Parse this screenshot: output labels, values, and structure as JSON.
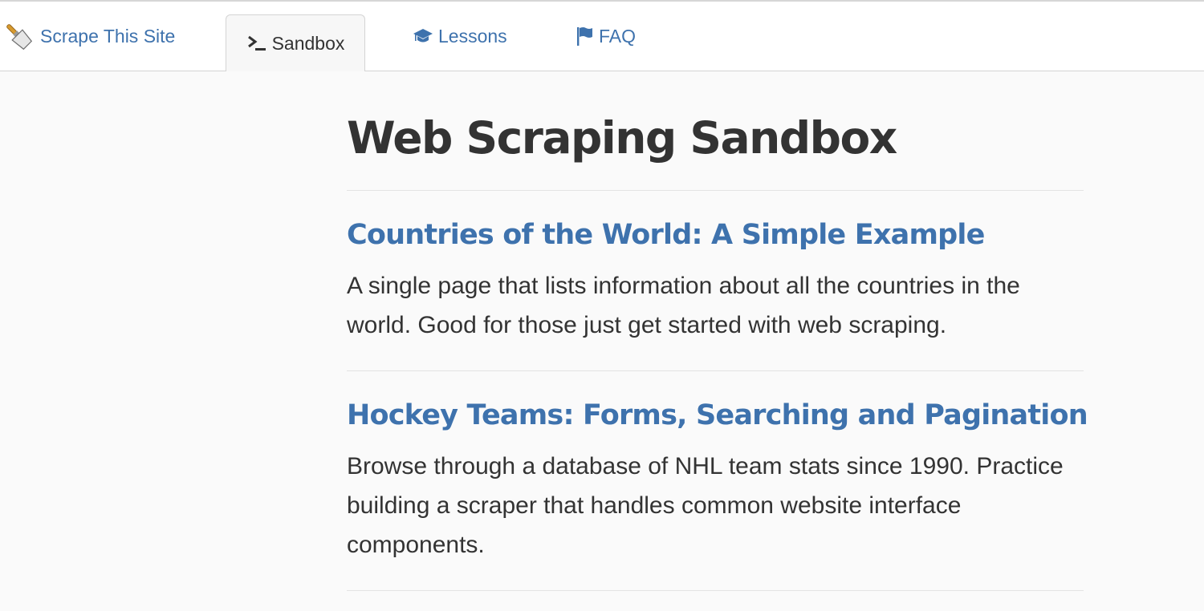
{
  "navbar": {
    "brand": {
      "label": "Scrape This Site",
      "icon": "spatula-icon"
    },
    "items": [
      {
        "label": "Sandbox",
        "icon": "terminal-icon",
        "active": true
      },
      {
        "label": "Lessons",
        "icon": "graduation-cap-icon",
        "active": false
      },
      {
        "label": "FAQ",
        "icon": "flag-icon",
        "active": false
      }
    ]
  },
  "main": {
    "title": "Web Scraping Sandbox",
    "sections": [
      {
        "title": "Countries of the World: A Simple Example",
        "description": "A single page that lists information about all the countries in the world. Good for those just get started with web scraping."
      },
      {
        "title": "Hockey Teams: Forms, Searching and Pagination",
        "description": "Browse through a database of NHL team stats since 1990. Practice building a scraper that handles common website interface components."
      }
    ]
  },
  "colors": {
    "link": "#3e72ad",
    "text": "#333333",
    "background": "#fafafa",
    "active_tab_bg": "#f7f7f7"
  }
}
